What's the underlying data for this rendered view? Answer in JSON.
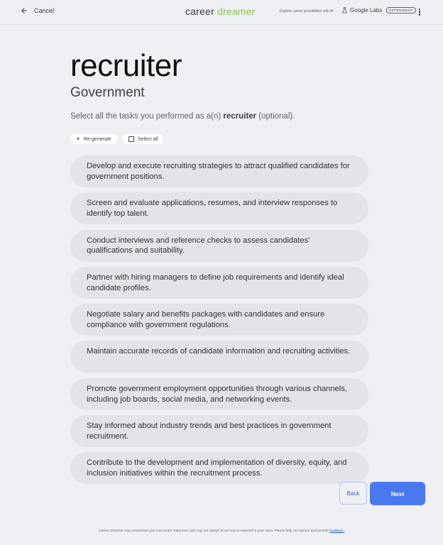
{
  "header": {
    "cancel_label": "Cancel",
    "brand_part1": "career ",
    "brand_part2": "dreamer",
    "tagline": "Explore career possibilities with AI",
    "labs_label": "Google Labs",
    "experiment_badge": "EXPERIMENT"
  },
  "main": {
    "title": "recruiter",
    "subtitle": "Government",
    "instruction_prefix": "Select all the tasks you performed as a(n) ",
    "instruction_role": "recruiter",
    "instruction_suffix": " (optional).",
    "regenerate_label": "Re-generate",
    "select_all_label": "Select all",
    "tasks": [
      "Develop and execute recruiting strategies to attract qualified candidates for government positions.",
      "Screen and evaluate applications, resumes, and interview responses to identify top talent.",
      "Conduct interviews and reference checks to assess candidates' qualifications and suitability.",
      "Partner with hiring managers to define job requirements and identify ideal candidate profiles.",
      "Negotiate salary and benefits packages with candidates and ensure compliance with government regulations.",
      "Maintain accurate records of candidate information and recruiting activities.",
      "Promote government employment opportunities through various channels, including job boards, social media, and networking events.",
      "Stay informed about industry trends and best practices in government recruitment.",
      "Contribute to the development and implementation of diversity, equity, and inclusion initiatives within the recruitment process."
    ]
  },
  "nav": {
    "back_label": "Back",
    "next_label": "Next"
  },
  "footer": {
    "text": "Career Dreamer may sometimes give inaccurate responses and may not always know how to respond to your input. Please help us improve and provide ",
    "link": "feedback."
  },
  "colors": {
    "accent": "#4a78ee",
    "brand_green": "#8bc34a",
    "background": "#eef0f4",
    "task_pill": "#e3e4e8"
  },
  "icons": {
    "back": "arrow-left-icon",
    "labs": "flask-icon",
    "menu": "more-vert-icon",
    "regenerate": "sparkle-icon",
    "select_all": "checkbox-icon"
  }
}
